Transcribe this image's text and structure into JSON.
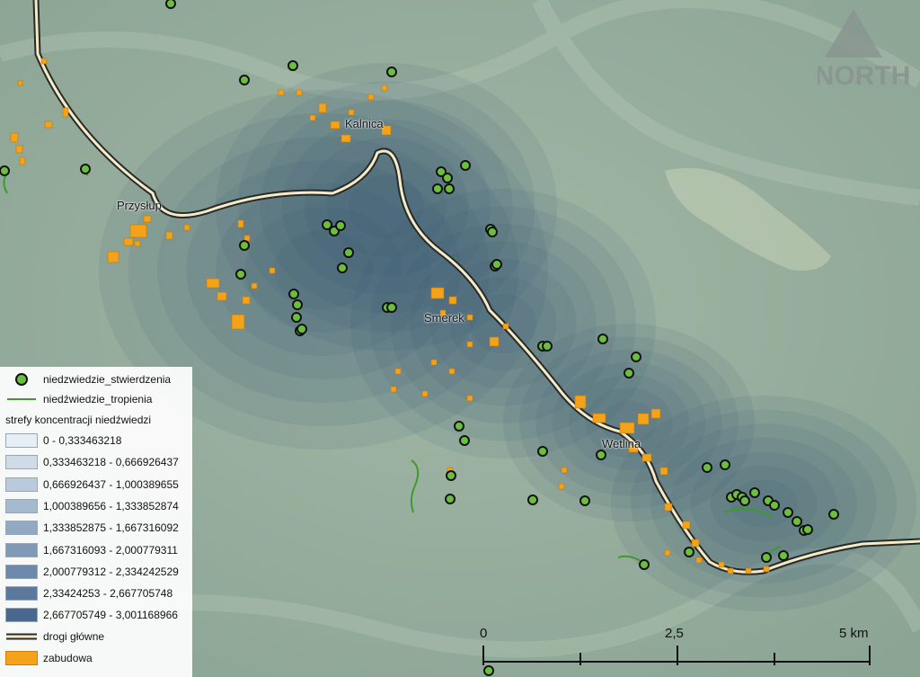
{
  "map": {
    "places": [
      {
        "id": "kalnica",
        "name": "Kalnica"
      },
      {
        "id": "przyslup",
        "name": "Przysłup"
      },
      {
        "id": "smerek",
        "name": "Smerek"
      },
      {
        "id": "wetlina",
        "name": "Wetlina"
      }
    ],
    "north_arrow": {
      "label": "NORTH",
      "icon": "north-arrow-icon"
    },
    "scale_bar": {
      "labels": [
        "0",
        "2,5",
        "5 km"
      ]
    },
    "colors": {
      "observation_fill": "#6cbf3c",
      "tracking_line": "#3e9b2a",
      "road_casing": "#2a2a2a",
      "road_center": "#f3ecc8",
      "buildings": "#f5a21b",
      "concentration_base": "#2e4f72"
    }
  },
  "legend": {
    "observations_label": "niedzwiedzie_stwierdzenia",
    "tracking_label": "niedźwiedzie_tropienia",
    "concentration_title": "strefy koncentracji niedźwiedzi",
    "classes": [
      {
        "label": "0 - 0,333463218",
        "color": "#e7eff6"
      },
      {
        "label": "0,333463218 - 0,666926437",
        "color": "#cfdbe7"
      },
      {
        "label": "0,666926437 - 1,000389655",
        "color": "#b9cadb"
      },
      {
        "label": "1,000389656 - 1,333852874",
        "color": "#a5bacf"
      },
      {
        "label": "1,333852875 - 1,667316092",
        "color": "#91a9c3"
      },
      {
        "label": "1,667316093 - 2,000779311",
        "color": "#7f99b7"
      },
      {
        "label": "2,000779312 - 2,334242529",
        "color": "#6c88aa"
      },
      {
        "label": "2,33424253 - 2,667705748",
        "color": "#5b789d"
      },
      {
        "label": "2,667705749 - 3,001168966",
        "color": "#4a688f"
      }
    ],
    "roads_label": "drogi główne",
    "buildings_label": "zabudowa"
  }
}
